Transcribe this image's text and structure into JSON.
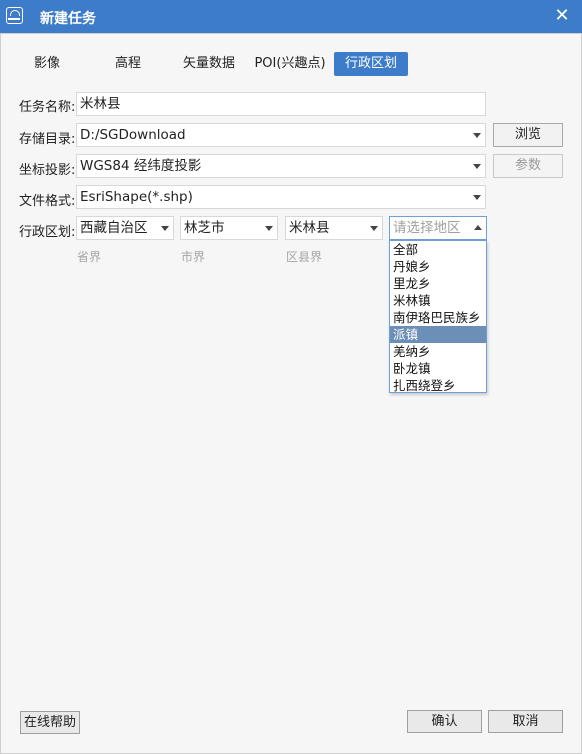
{
  "window": {
    "title": "新建任务",
    "close_glyph": "✕"
  },
  "tabs": [
    {
      "label": "影像"
    },
    {
      "label": "高程"
    },
    {
      "label": "矢量数据"
    },
    {
      "label": "POI(兴趣点)"
    },
    {
      "label": "行政区划",
      "active": true
    }
  ],
  "form": {
    "task_name_label": "任务名称:",
    "task_name_value": "米林县",
    "storage_label": "存储目录:",
    "storage_value": "D:/SGDownload",
    "browse_button": "浏览",
    "projection_label": "坐标投影:",
    "projection_value": "WGS84 经纬度投影",
    "params_button": "参数",
    "format_label": "文件格式:",
    "format_value": "EsriShape(*.shp)",
    "region_label": "行政区划:",
    "province_value": "西藏自治区",
    "city_value": "林芝市",
    "county_value": "米林县",
    "district_placeholder": "请选择地区",
    "province_caption": "省界",
    "city_caption": "市界",
    "county_caption": "区县界"
  },
  "district_dropdown": {
    "items": [
      "全部",
      "丹娘乡",
      "里龙乡",
      "米林镇",
      "南伊珞巴民族乡",
      "派镇",
      "羌纳乡",
      "卧龙镇",
      "扎西绕登乡"
    ],
    "selected_index": 5
  },
  "footer": {
    "help_button": "在线帮助",
    "ok_button": "确认",
    "cancel_button": "取消"
  },
  "colors": {
    "accent": "#3d7cc9",
    "dropdown_highlight": "#6c8fb8"
  }
}
